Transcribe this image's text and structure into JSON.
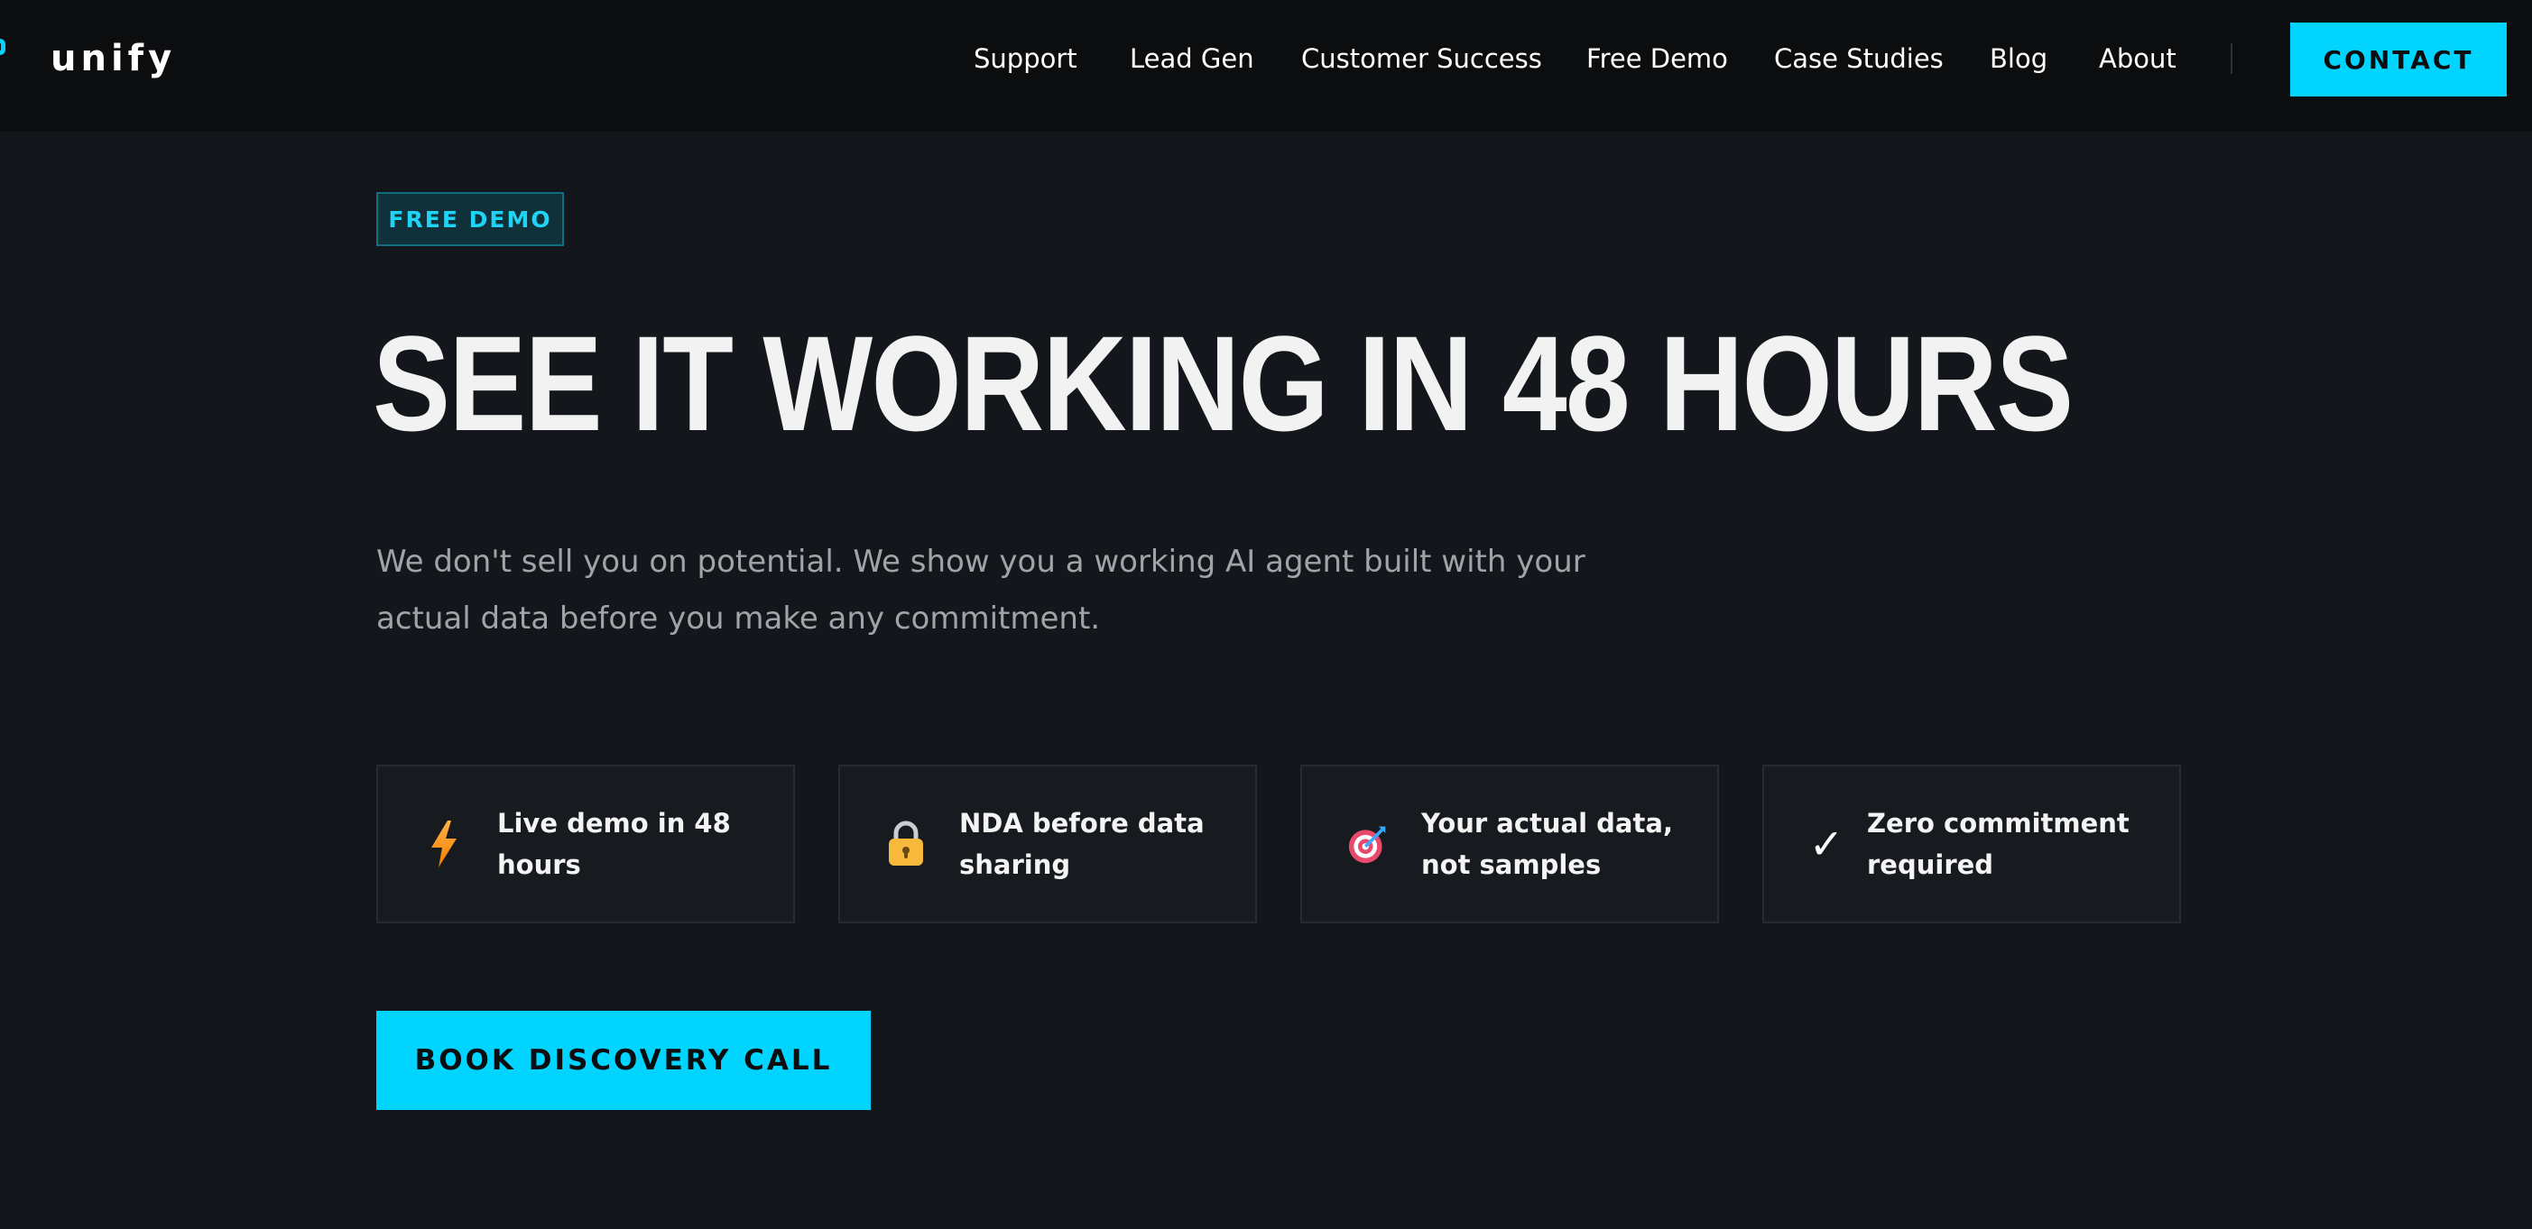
{
  "brand": {
    "name": "unify",
    "accent_color": "#00d4ff"
  },
  "nav": {
    "items": [
      {
        "label": "Support"
      },
      {
        "label": "Lead Gen"
      },
      {
        "label": "Customer Success"
      },
      {
        "label": "Free Demo"
      },
      {
        "label": "Case Studies"
      },
      {
        "label": "Blog"
      },
      {
        "label": "About"
      }
    ],
    "contact_label": "CONTACT"
  },
  "hero": {
    "badge": "FREE DEMO",
    "title": "SEE IT WORKING IN 48 HOURS",
    "subtitle_line1": "We don't sell you on potential. We show you a working AI agent built with your",
    "subtitle_line2": "actual data before you make any commitment."
  },
  "features": [
    {
      "icon": "lightning-icon",
      "line1": "Live demo in 48",
      "line2": "hours"
    },
    {
      "icon": "lock-icon",
      "line1": "NDA before data",
      "line2": "sharing"
    },
    {
      "icon": "target-icon",
      "line1": "Your actual data,",
      "line2": "not samples"
    },
    {
      "icon": "checkmark-icon",
      "glyph": "✓",
      "line1": "Zero commitment",
      "line2": "required"
    }
  ],
  "cta": {
    "label": "BOOK DISCOVERY CALL"
  }
}
